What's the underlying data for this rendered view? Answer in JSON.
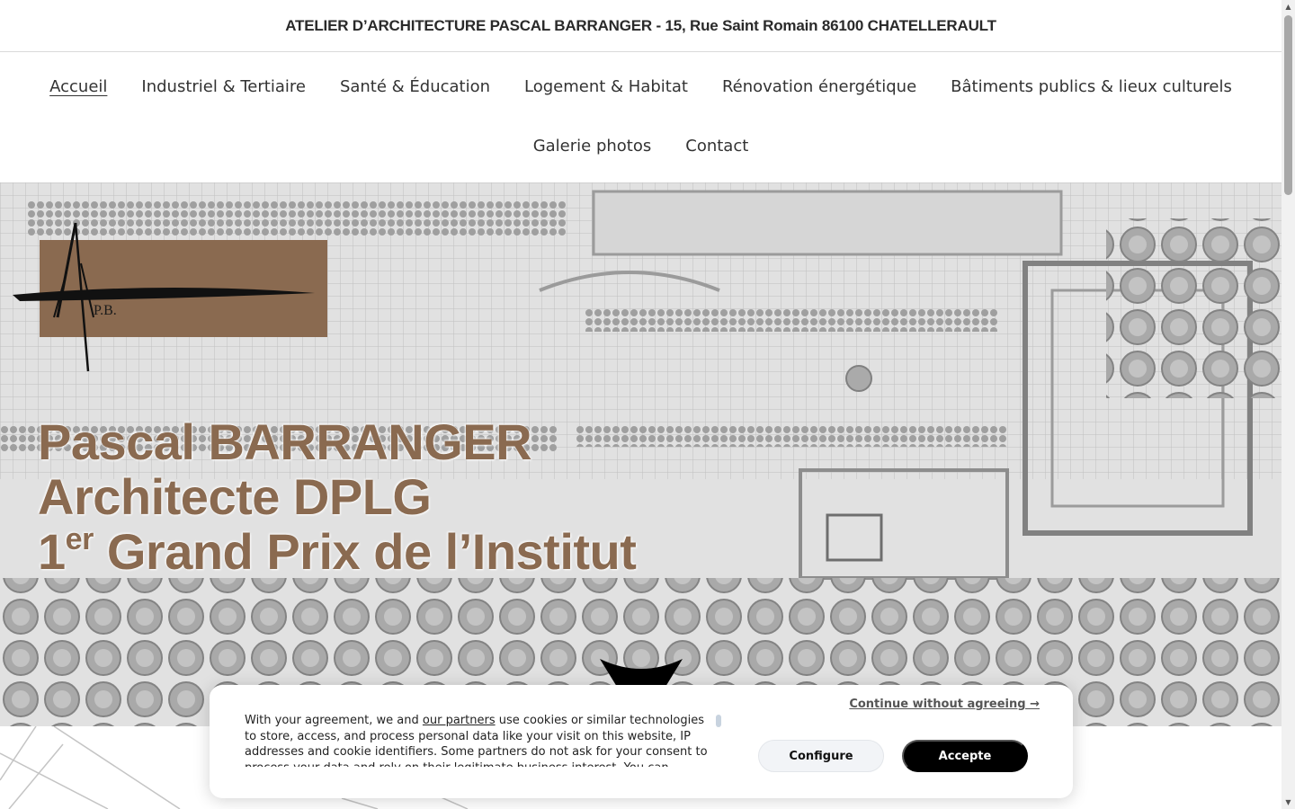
{
  "header": {
    "address": "ATELIER D’ARCHITECTURE PASCAL BARRANGER - 15, Rue Saint Romain 86100 CHATELLERAULT"
  },
  "nav": {
    "items": [
      {
        "label": "Accueil",
        "active": true
      },
      {
        "label": "Industriel & Tertiaire"
      },
      {
        "label": "Santé & Éducation"
      },
      {
        "label": "Logement & Habitat"
      },
      {
        "label": "Rénovation énergétique"
      },
      {
        "label": "Bâtiments publics & lieux culturels"
      },
      {
        "label": "Galerie photos"
      },
      {
        "label": "Contact"
      }
    ]
  },
  "hero": {
    "logo_initials": "P.B.",
    "title_line1": "Pascal BARRANGER",
    "title_line2": "Architecte DPLG",
    "title_line3_num": "1",
    "title_line3_sup": "er",
    "title_line3_rest": " Grand Prix de l’Institut",
    "brand_color": "#8a6a50"
  },
  "cookie": {
    "text_before": "With your agreement, we and ",
    "partners_link": "our partners",
    "text_after": " use cookies or similar technologies to store, access, and process personal data like your visit on this website, IP addresses and cookie identifiers. Some partners do not ask for your consent to process your data and rely on their legitimate business interest. You can",
    "continue_label": "Continue without agreeing →",
    "configure_label": "Configure",
    "accept_label": "Accepte"
  },
  "icons": {
    "scroll_up": "▲",
    "scroll_down": "▼"
  }
}
